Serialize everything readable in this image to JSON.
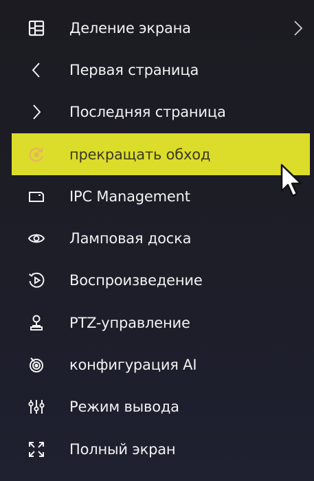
{
  "menu": {
    "items": [
      {
        "id": "split",
        "icon": "grid-split-icon",
        "label": "Деление экрана",
        "has_submenu": true,
        "active": false
      },
      {
        "id": "first",
        "icon": "chevron-left-icon",
        "label": "Первая страница",
        "has_submenu": false,
        "active": false
      },
      {
        "id": "last",
        "icon": "chevron-right-icon",
        "label": "Последняя страница",
        "has_submenu": false,
        "active": false
      },
      {
        "id": "stop-patrol",
        "icon": "stop-patrol-icon",
        "label": "прекращать обход",
        "has_submenu": false,
        "active": true
      },
      {
        "id": "ipc",
        "icon": "camera-card-icon",
        "label": "IPC Management",
        "has_submenu": false,
        "active": false
      },
      {
        "id": "lamp",
        "icon": "eye-icon",
        "label": "Ламповая доска",
        "has_submenu": false,
        "active": false
      },
      {
        "id": "playback",
        "icon": "playback-icon",
        "label": "Воспроизведение",
        "has_submenu": false,
        "active": false
      },
      {
        "id": "ptz",
        "icon": "ptz-person-icon",
        "label": "PTZ-управление",
        "has_submenu": false,
        "active": false
      },
      {
        "id": "ai",
        "icon": "ai-config-icon",
        "label": "конфигурация AI",
        "has_submenu": false,
        "active": false
      },
      {
        "id": "output",
        "icon": "sliders-icon",
        "label": "Режим вывода",
        "has_submenu": false,
        "active": false
      },
      {
        "id": "fullscreen",
        "icon": "fullscreen-icon",
        "label": "Полный экран",
        "has_submenu": false,
        "active": false
      }
    ]
  },
  "colors": {
    "background": "#1d1d26",
    "text": "#f2f2f2",
    "highlight": "#dcdc2a",
    "highlight_text": "#3a3a22"
  }
}
